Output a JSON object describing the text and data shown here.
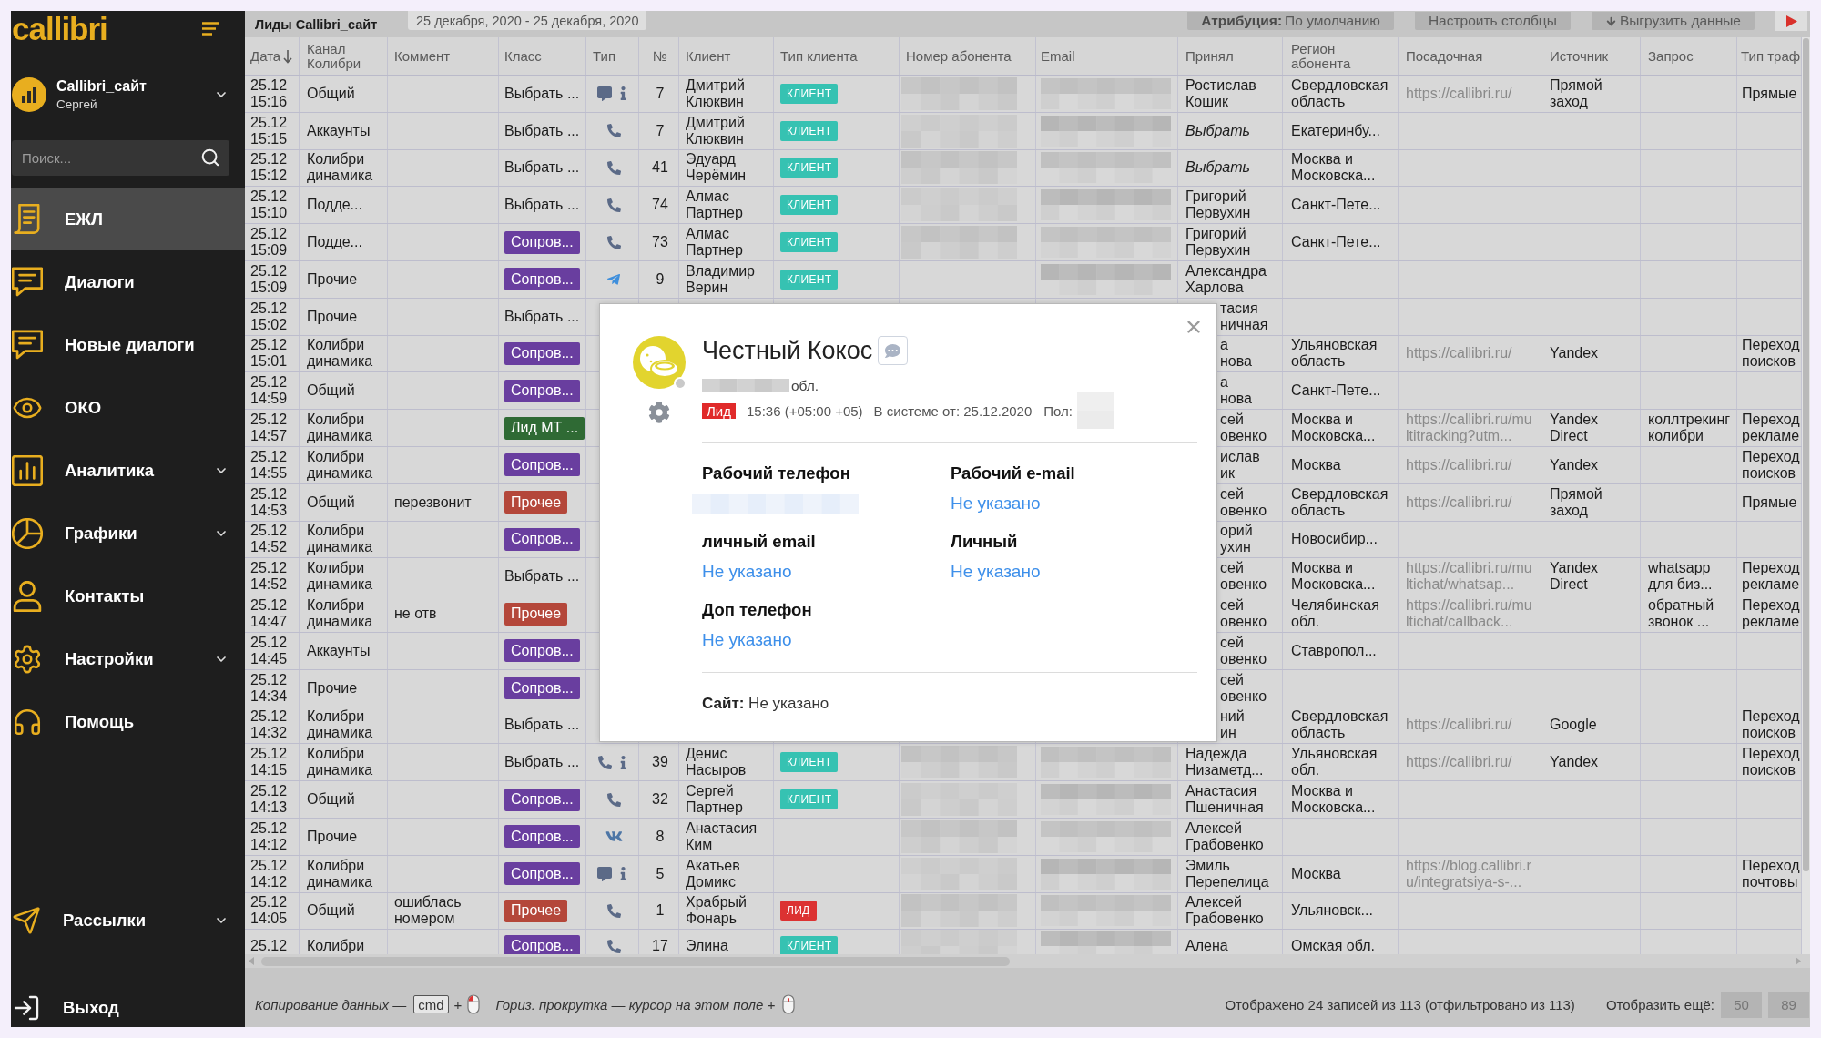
{
  "sidebar": {
    "logo": "callibri",
    "account": {
      "name": "Callibri_сайт",
      "user": "Сергей"
    },
    "search": {
      "placeholder": "Поиск..."
    },
    "items": [
      {
        "label": "ЕЖЛ",
        "selected": true,
        "expandable": false
      },
      {
        "label": "Диалоги",
        "selected": false,
        "expandable": false
      },
      {
        "label": "Новые диалоги",
        "selected": false,
        "expandable": false
      },
      {
        "label": "ОКО",
        "selected": false,
        "expandable": false
      },
      {
        "label": "Аналитика",
        "selected": false,
        "expandable": true
      },
      {
        "label": "Графики",
        "selected": false,
        "expandable": true
      },
      {
        "label": "Контакты",
        "selected": false,
        "expandable": false
      },
      {
        "label": "Настройки",
        "selected": false,
        "expandable": true
      },
      {
        "label": "Помощь",
        "selected": false,
        "expandable": false
      }
    ],
    "bottom_items": [
      {
        "label": "Рассылки",
        "selected": false,
        "expandable": true
      }
    ],
    "logout": "Выход"
  },
  "toolbar": {
    "title": "Лиды Callibri_сайт",
    "date_range": "25 декабря, 2020 - 25 декабря, 2020",
    "attribution": "**Атрибуция:** По умолчанию",
    "buttons": [
      {
        "label": "Настроить столбцы",
        "kind": "plain"
      },
      {
        "label": "Выгрузить данные",
        "kind": "download"
      }
    ]
  },
  "table": {
    "columns": [
      {
        "label": "Дата",
        "sorted": true
      },
      {
        "label": "Канал Колибри",
        "sorted": false
      },
      {
        "label": "Коммент",
        "sorted": false
      },
      {
        "label": "Класс",
        "sorted": false
      },
      {
        "label": "Тип",
        "sorted": false
      },
      {
        "label": "№",
        "sorted": false
      },
      {
        "label": "Клиент",
        "sorted": false
      },
      {
        "label": "Тип клиента",
        "sorted": false
      },
      {
        "label": "Номер абонента",
        "sorted": false
      },
      {
        "label": "Email",
        "sorted": false
      },
      {
        "label": "Принял",
        "sorted": false
      },
      {
        "label": "Регион абонента",
        "sorted": false
      },
      {
        "label": "Посадочная",
        "sorted": false
      },
      {
        "label": "Источник",
        "sorted": false
      },
      {
        "label": "Запрос",
        "sorted": false
      },
      {
        "label": "Тип траф",
        "sorted": false
      }
    ],
    "rows": [
      {
        "date": "25.12 15:16",
        "channel_name": "Общий",
        "class": {
          "label": "Выбрать ...",
          "kind": "prompt"
        },
        "channel": {
          "kind": "chat",
          "info": true
        },
        "number": "7",
        "client": "Дмитрий Клюквин",
        "client_type": {
          "label": "КЛИЕНТ",
          "color": "#36c2b2"
        },
        "phone_blurred": true,
        "email_blurred": true,
        "accepted": {
          "text": "Ростислав Кошик",
          "kind": "name"
        },
        "region": "Свердловская область",
        "landing": "https://callibri.ru/",
        "source": "Прямой заход",
        "traffic": "Прямые"
      },
      {
        "date": "25.12 15:15",
        "channel_name": "Аккаунты",
        "class": {
          "label": "Выбрать ...",
          "kind": "prompt"
        },
        "channel": {
          "kind": "call",
          "info": false
        },
        "number": "7",
        "client": "Дмитрий Клюквин",
        "client_type": {
          "label": "КЛИЕНТ",
          "color": "#36c2b2"
        },
        "phone_blurred": true,
        "email_blurred": true,
        "accepted": {
          "text": "Выбрать",
          "kind": "prompt"
        },
        "region": "Екатеринбу..."
      },
      {
        "date": "25.12 15:12",
        "channel_name": "Колибри динамика",
        "class": {
          "label": "Выбрать ...",
          "kind": "prompt"
        },
        "channel": {
          "kind": "call",
          "info": false
        },
        "number": "41",
        "client": "Эдуард Черёмин",
        "client_type": {
          "label": "КЛИЕНТ",
          "color": "#36c2b2"
        },
        "phone_blurred": true,
        "email_blurred": true,
        "accepted": {
          "text": "Выбрать",
          "kind": "prompt"
        },
        "region": "Москва и Московска..."
      },
      {
        "date": "25.12 15:10",
        "channel_name": "Подде...",
        "class": {
          "label": "Выбрать ...",
          "kind": "prompt"
        },
        "channel": {
          "kind": "call",
          "info": false
        },
        "number": "74",
        "client": "Алмас Партнер",
        "client_type": {
          "label": "КЛИЕНТ",
          "color": "#36c2b2"
        },
        "phone_blurred": true,
        "email_blurred": true,
        "accepted": {
          "text": "Григорий Первухин",
          "kind": "name"
        },
        "region": "Санкт-Пете..."
      },
      {
        "date": "25.12 15:09",
        "channel_name": "Подде...",
        "class": {
          "label": "Сопров...",
          "kind": "tag",
          "color": "#693e9f"
        },
        "channel": {
          "kind": "call",
          "info": false
        },
        "number": "73",
        "client": "Алмас Партнер",
        "client_type": {
          "label": "КЛИЕНТ",
          "color": "#36c2b2"
        },
        "phone_blurred": true,
        "email_blurred": true,
        "accepted": {
          "text": "Григорий Первухин",
          "kind": "name"
        },
        "region": "Санкт-Пете..."
      },
      {
        "date": "25.12 15:09",
        "channel_name": "Прочие",
        "class": {
          "label": "Сопров...",
          "kind": "tag",
          "color": "#693e9f"
        },
        "channel": {
          "kind": "telegram",
          "info": false
        },
        "number": "9",
        "client": "Владимир Верин",
        "client_type": {
          "label": "КЛИЕНТ",
          "color": "#36c2b2"
        },
        "phone_blurred": false,
        "email_blurred": true,
        "accepted": {
          "text": "Александра Харлова",
          "kind": "name"
        }
      },
      {
        "date": "25.12 15:02",
        "channel_name": "Прочие",
        "class": {
          "label": "Выбрать ...",
          "kind": "prompt"
        },
        "phone_blurred": false,
        "email_blurred": false,
        "accepted": {
          "text": "тасия\nничная",
          "kind": "partial"
        }
      },
      {
        "date": "25.12 15:01",
        "channel_name": "Колибри динамика",
        "class": {
          "label": "Сопров...",
          "kind": "tag",
          "color": "#693e9f"
        },
        "phone_blurred": false,
        "email_blurred": false,
        "accepted": {
          "text": "а\nнова",
          "kind": "partial"
        },
        "region": "Ульяновская область",
        "landing": "https://callibri.ru/",
        "source": "Yandex",
        "traffic": "Переход поисков"
      },
      {
        "date": "25.12 14:59",
        "channel_name": "Общий",
        "class": {
          "label": "Сопров...",
          "kind": "tag",
          "color": "#693e9f"
        },
        "phone_blurred": false,
        "email_blurred": false,
        "accepted": {
          "text": "а\nнова",
          "kind": "partial"
        },
        "region": "Санкт-Пете..."
      },
      {
        "date": "25.12 14:57",
        "channel_name": "Колибри динамика",
        "class": {
          "label": "Лид МТ ...",
          "kind": "tag",
          "color": "#2f6a34"
        },
        "phone_blurred": false,
        "email_blurred": false,
        "accepted": {
          "text": "сей\nовенко",
          "kind": "partial"
        },
        "region": "Москва и Московска...",
        "landing": "https://callibri.ru/multitracking?utm...",
        "source": "Yandex Direct",
        "query": "коллтрекинг колибри",
        "traffic": "Переход рекламе"
      },
      {
        "date": "25.12 14:55",
        "channel_name": "Колибри динамика",
        "class": {
          "label": "Сопров...",
          "kind": "tag",
          "color": "#693e9f"
        },
        "phone_blurred": false,
        "email_blurred": false,
        "accepted": {
          "text": "ислав\nик",
          "kind": "partial"
        },
        "region": "Москва",
        "landing": "https://callibri.ru/",
        "source": "Yandex",
        "traffic": "Переход поисков"
      },
      {
        "date": "25.12 14:53",
        "channel_name": "Общий",
        "comment": "перезвонит",
        "class": {
          "label": "Прочее",
          "kind": "tag",
          "color": "#b4473a"
        },
        "phone_blurred": false,
        "email_blurred": false,
        "accepted": {
          "text": "сей\nовенко",
          "kind": "partial"
        },
        "region": "Свердловская область",
        "landing": "https://callibri.ru/",
        "source": "Прямой заход",
        "traffic": "Прямые"
      },
      {
        "date": "25.12 14:52",
        "channel_name": "Колибри динамика",
        "class": {
          "label": "Сопров...",
          "kind": "tag",
          "color": "#693e9f"
        },
        "phone_blurred": false,
        "email_blurred": false,
        "accepted": {
          "text": "орий\nухин",
          "kind": "partial"
        },
        "region": "Новосибир..."
      },
      {
        "date": "25.12 14:52",
        "channel_name": "Колибри динамика",
        "class": {
          "label": "Выбрать ...",
          "kind": "prompt"
        },
        "phone_blurred": false,
        "email_blurred": false,
        "accepted": {
          "text": "сей\nовенко",
          "kind": "partial"
        },
        "region": "Москва и Московска...",
        "landing": "https://callibri.ru/multichat/whatsap...",
        "source": "Yandex Direct",
        "query": "whatsapp для биз...",
        "traffic": "Переход рекламе"
      },
      {
        "date": "25.12 14:47",
        "channel_name": "Колибри динамика",
        "comment": "не отв",
        "class": {
          "label": "Прочее",
          "kind": "tag",
          "color": "#b4473a"
        },
        "phone_blurred": false,
        "email_blurred": false,
        "accepted": {
          "text": "сей\nовенко",
          "kind": "partial"
        },
        "region": "Челябинская обл.",
        "landing": "https://callibri.ru/multichat/callback...",
        "query": "обратный звонок ...",
        "traffic": "Переход рекламе"
      },
      {
        "date": "25.12 14:45",
        "channel_name": "Аккаунты",
        "class": {
          "label": "Сопров...",
          "kind": "tag",
          "color": "#693e9f"
        },
        "phone_blurred": false,
        "email_blurred": false,
        "accepted": {
          "text": "сей\nовенко",
          "kind": "partial"
        },
        "region": "Ставропол..."
      },
      {
        "date": "25.12 14:34",
        "channel_name": "Прочие",
        "class": {
          "label": "Сопров...",
          "kind": "tag",
          "color": "#693e9f"
        },
        "phone_blurred": false,
        "email_blurred": false,
        "accepted": {
          "text": "сей\nовенко",
          "kind": "partial"
        }
      },
      {
        "date": "25.12 14:32",
        "channel_name": "Колибри динамика",
        "class": {
          "label": "Выбрать ...",
          "kind": "prompt"
        },
        "phone_blurred": false,
        "email_blurred": false,
        "accepted": {
          "text": "ний\nин",
          "kind": "partial"
        },
        "region": "Свердловская область",
        "landing": "https://callibri.ru/",
        "source": "Google",
        "traffic": "Переход поисков"
      },
      {
        "date": "25.12 14:15",
        "channel_name": "Колибри динамика",
        "class": {
          "label": "Выбрать ...",
          "kind": "prompt"
        },
        "channel": {
          "kind": "call",
          "info": true
        },
        "number": "39",
        "client": "Денис Насыров",
        "client_type": {
          "label": "КЛИЕНТ",
          "color": "#36c2b2"
        },
        "phone_blurred": true,
        "email_blurred": true,
        "accepted": {
          "text": "Надежда Низаметд...",
          "kind": "name"
        },
        "region": "Ульяновская обл.",
        "landing": "https://callibri.ru/",
        "source": "Yandex",
        "traffic": "Переход поисков"
      },
      {
        "date": "25.12 14:13",
        "channel_name": "Общий",
        "class": {
          "label": "Сопров...",
          "kind": "tag",
          "color": "#693e9f"
        },
        "channel": {
          "kind": "call",
          "info": false
        },
        "number": "32",
        "client": "Сергей Партнер",
        "client_type": {
          "label": "КЛИЕНТ",
          "color": "#36c2b2"
        },
        "phone_blurred": true,
        "email_blurred": true,
        "accepted": {
          "text": "Анастасия Пшеничная",
          "kind": "name"
        },
        "region": "Москва и Московска..."
      },
      {
        "date": "25.12 14:12",
        "channel_name": "Прочие",
        "class": {
          "label": "Сопров...",
          "kind": "tag",
          "color": "#693e9f"
        },
        "channel": {
          "kind": "vk",
          "info": false
        },
        "number": "8",
        "client": "Анастасия Ким",
        "phone_blurred": true,
        "email_blurred": true,
        "accepted": {
          "text": "Алексей Грабовенко",
          "kind": "name"
        }
      },
      {
        "date": "25.12 14:12",
        "channel_name": "Колибри динамика",
        "class": {
          "label": "Сопров...",
          "kind": "tag",
          "color": "#693e9f"
        },
        "channel": {
          "kind": "chat",
          "info": true
        },
        "number": "5",
        "client": "Акатьев Домикс",
        "phone_blurred": true,
        "email_blurred": true,
        "accepted": {
          "text": "Эмиль Перепелица",
          "kind": "name"
        },
        "region": "Москва",
        "landing": "https://blog.callibri.ru/integratsiya-s-...",
        "traffic": "Переход почтовы"
      },
      {
        "date": "25.12 14:05",
        "channel_name": "Общий",
        "comment": "ошиблась номером",
        "class": {
          "label": "Прочее",
          "kind": "tag",
          "color": "#b4473a"
        },
        "channel": {
          "kind": "call",
          "info": false
        },
        "number": "1",
        "client": "Храбрый Фонарь",
        "client_type": {
          "label": "ЛИД",
          "color": "#dc3232"
        },
        "phone_blurred": true,
        "email_blurred": true,
        "accepted": {
          "text": "Алексей Грабовенко",
          "kind": "name"
        },
        "region": "Ульяновск..."
      },
      {
        "date": "25.12",
        "channel_name": "Колибри",
        "class": {
          "label": "Сопров...",
          "kind": "tag",
          "color": "#693e9f"
        },
        "channel": {
          "kind": "call",
          "info": false
        },
        "number": "17",
        "client": "Элина",
        "client_type": {
          "label": "КЛИЕНТ",
          "color": "#36c2b2"
        },
        "phone_blurred": true,
        "email_blurred": true,
        "accepted": {
          "text": "Алена",
          "kind": "name"
        },
        "region": "Омская обл."
      }
    ]
  },
  "contact_card": {
    "name": "Честный Кокос",
    "online": false,
    "region_suffix": "обл.",
    "status_badge": "Лид",
    "local_time": "15:36 (+05:00 +05)",
    "since": "В системе от: 25.12.2020",
    "gender_label": "Пол:",
    "fields": [
      {
        "label": "Рабочий телефон",
        "blurred": true
      },
      {
        "label": "Рабочий e-mail",
        "value": "Не указано",
        "blurred": false
      },
      {
        "label": "личный email",
        "value": "Не указано",
        "blurred": false
      },
      {
        "label": "Личный",
        "value": "Не указано",
        "blurred": false
      },
      {
        "label": "Доп телефон",
        "value": "Не указано",
        "blurred": false
      }
    ],
    "site": "**Сайт:** Не указано"
  },
  "footer": {
    "copy_hint": "Копирование данных —",
    "copy_key": "cmd",
    "copy_plus": "+",
    "scroll_hint": "Гориз. прокрутка — курсор на этом поле +",
    "summary": "Отображено 24 записей из 113 (отфильтровано из 113)",
    "show_more_label": "Отобразить ещё:",
    "show_more_options": [
      "50",
      "89"
    ]
  }
}
